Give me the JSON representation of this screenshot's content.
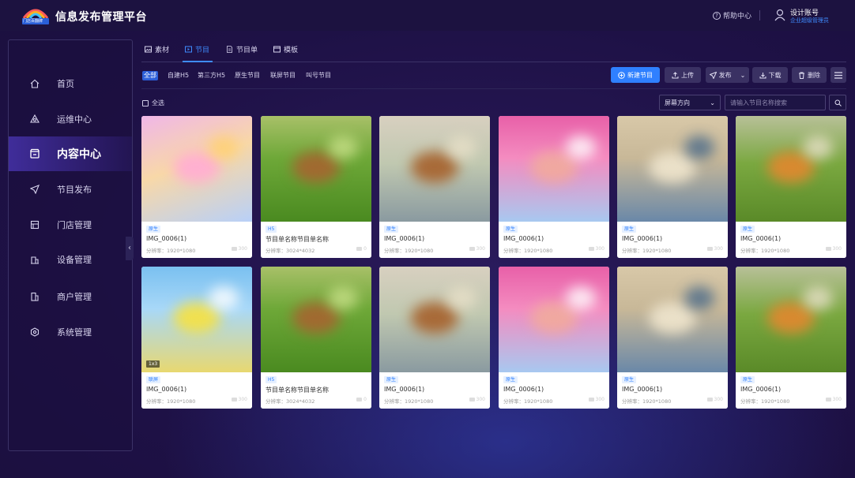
{
  "header": {
    "logo_text": "门店百翻牌",
    "app_title": "信息发布管理平台",
    "help_label": "帮助中心",
    "user_name": "设计账号",
    "user_role": "企业超级管理员"
  },
  "sidebar": {
    "items": [
      {
        "label": "首页",
        "icon": "home-icon"
      },
      {
        "label": "运维中心",
        "icon": "ops-icon"
      },
      {
        "label": "内容中心",
        "icon": "content-icon",
        "active": true
      },
      {
        "label": "节目发布",
        "icon": "send-icon"
      },
      {
        "label": "门店管理",
        "icon": "store-icon"
      },
      {
        "label": "设备管理",
        "icon": "device-icon"
      },
      {
        "label": "商户管理",
        "icon": "merchant-icon"
      },
      {
        "label": "系统管理",
        "icon": "settings-icon"
      }
    ]
  },
  "tabs": [
    {
      "label": "素材",
      "icon": "image-icon"
    },
    {
      "label": "节目",
      "icon": "program-icon",
      "active": true
    },
    {
      "label": "节目单",
      "icon": "playlist-icon"
    },
    {
      "label": "模板",
      "icon": "template-icon"
    }
  ],
  "filters": [
    "全部",
    "自建H5",
    "第三方H5",
    "原生节目",
    "联屏节目",
    "叫号节目"
  ],
  "actions": {
    "new": "新建节目",
    "upload": "上传",
    "publish": "发布",
    "download": "下载",
    "delete": "删除"
  },
  "toolbar": {
    "select_all": "全选",
    "orientation": "屏幕方向",
    "search_placeholder": "请输入节目名称搜索"
  },
  "colors": {
    "accent": "#2f80ff",
    "background": "#1e1146",
    "card": "#ffffff"
  },
  "cards": [
    {
      "badge": "原生",
      "name": "IMG_0006(1)",
      "res": "分辨率：1920*1080",
      "count": "300",
      "theme": "pastel"
    },
    {
      "badge": "H5",
      "name": "节目单名称节目单名称",
      "res": "分辨率：3024*4032",
      "count": "0",
      "theme": "forest"
    },
    {
      "badge": "原生",
      "name": "IMG_0006(1)",
      "res": "分辨率：1920*1080",
      "count": "300",
      "theme": "snail"
    },
    {
      "badge": "原生",
      "name": "IMG_0006(1)",
      "res": "分辨率：1920*1080",
      "count": "300",
      "theme": "pink"
    },
    {
      "badge": "原生",
      "name": "IMG_0006(1)",
      "res": "分辨率：1920*1080",
      "count": "300",
      "theme": "wave"
    },
    {
      "badge": "原生",
      "name": "IMG_0006(1)",
      "res": "分辨率：1920*1080",
      "count": "300",
      "theme": "fox"
    },
    {
      "badge": "联屏",
      "name": "IMG_0006(1)",
      "res": "分辨率：1920*1080",
      "count": "300",
      "theme": "sky",
      "tag": "1x3"
    },
    {
      "badge": "H5",
      "name": "节目单名称节目单名称",
      "res": "分辨率：3024*4032",
      "count": "0",
      "theme": "forest"
    },
    {
      "badge": "原生",
      "name": "IMG_0006(1)",
      "res": "分辨率：1920*1080",
      "count": "300",
      "theme": "snail"
    },
    {
      "badge": "原生",
      "name": "IMG_0006(1)",
      "res": "分辨率：1920*1080",
      "count": "300",
      "theme": "pink"
    },
    {
      "badge": "原生",
      "name": "IMG_0006(1)",
      "res": "分辨率：1920*1080",
      "count": "300",
      "theme": "wave"
    },
    {
      "badge": "原生",
      "name": "IMG_0006(1)",
      "res": "分辨率：1920*1080",
      "count": "300",
      "theme": "fox"
    }
  ]
}
